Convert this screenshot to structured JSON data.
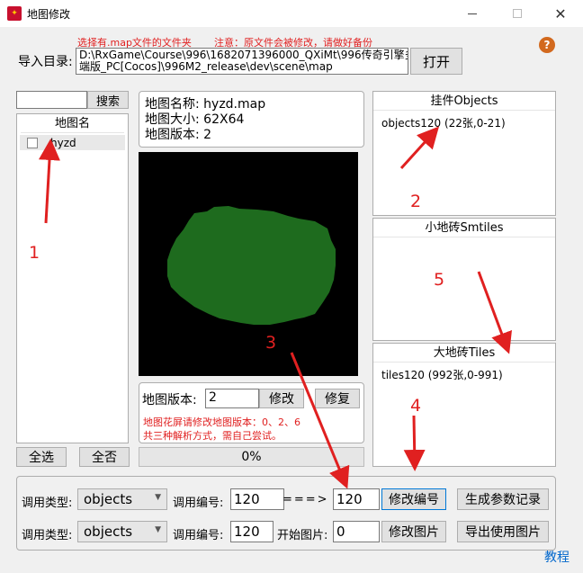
{
  "window": {
    "title": "地图修改"
  },
  "import": {
    "hint": "选择有.map文件的文件夹",
    "warning": "注意：原文件会被修改，请做好备份",
    "label": "导入目录:",
    "path_line1": "D:\\RxGame\\Course\\996\\1682071396000_QXiMt\\996传奇引擎多",
    "path_line2": "端版_PC[Cocos]\\996M2_release\\dev\\scene\\map",
    "open_button": "打开"
  },
  "search": {
    "button": "搜索",
    "value": ""
  },
  "map_list": {
    "header": "地图名",
    "items": [
      {
        "name": "hyzd",
        "checked": false
      }
    ]
  },
  "map_info": {
    "name_line": "地图名称: hyzd.map",
    "size_line": "地图大小: 62X64",
    "version_line": "地图版本: 2"
  },
  "version_edit": {
    "label": "地图版本:",
    "value": "2",
    "modify_button": "修改",
    "repair_button": "修复",
    "note_line1": "地图花屏请修改地图版本：0、2、6",
    "note_line2": "共三种解析方式，需自己尝试。"
  },
  "progress": {
    "text": "0%",
    "fraction": 0
  },
  "objects_panel": {
    "header": "挂件Objects",
    "items": [
      "objects120 (22张,0-21)"
    ]
  },
  "smtiles_panel": {
    "header": "小地砖Smtiles",
    "items": []
  },
  "tiles_panel": {
    "header": "大地砖Tiles",
    "items": [
      "tiles120 (992张,0-991)"
    ]
  },
  "select_all": "全选",
  "select_none": "全否",
  "row1": {
    "type_label": "调用类型:",
    "type_value": "objects",
    "num_label": "调用编号:",
    "num_value": "120",
    "arrow_text": "===>",
    "target_value": "120",
    "modify_num_button": "修改编号",
    "generate_button": "生成参数记录"
  },
  "row2": {
    "type_label": "调用类型:",
    "type_value": "objects",
    "num_label": "调用编号:",
    "num_value": "120",
    "start_label": "开始图片:",
    "start_value": "0",
    "modify_img_button": "修改图片",
    "export_button": "导出使用图片"
  },
  "tutorial_link": "教程",
  "annotations": [
    "1",
    "2",
    "3",
    "4",
    "5"
  ],
  "colors": {
    "annotation_red": "#e02020",
    "map_green": "#1e6b1e",
    "map_bg": "#000000",
    "link_blue": "#0066cc"
  },
  "icons": {
    "help": "help-icon",
    "app": "app-icon"
  }
}
